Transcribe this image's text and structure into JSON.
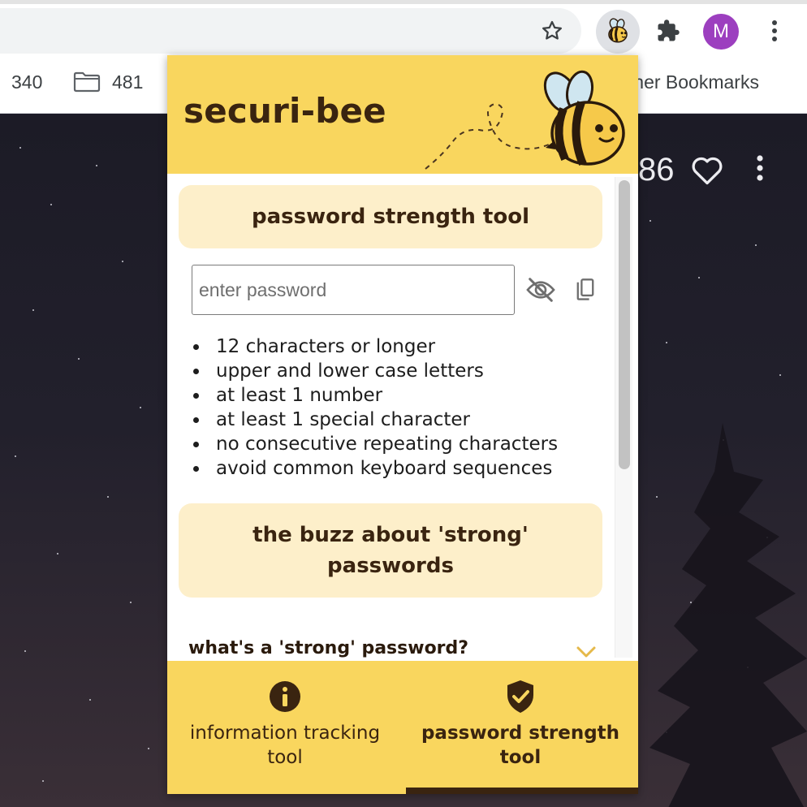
{
  "browser": {
    "avatar_letter": "M",
    "icons": {
      "bookmark": "star-outline-icon",
      "extension": "bee-icon",
      "extensions_menu": "puzzle-icon",
      "menu": "kebab-icon"
    },
    "bookmarks_bar": {
      "items": [
        {
          "label": "340"
        },
        {
          "label": "481",
          "icon": "folder-icon"
        }
      ],
      "other_bookmarks": "Other Bookmarks"
    }
  },
  "page": {
    "counter_text": "86",
    "icons": {
      "like": "heart-outline-icon",
      "more": "kebab-icon"
    }
  },
  "popup": {
    "app_name": "securi-bee",
    "colors": {
      "brand_yellow": "#f9d65e",
      "card": "#fdefca",
      "brand_brown": "#3a2410"
    },
    "tool_heading": "password strength tool",
    "password_input": {
      "placeholder": "enter password",
      "value": ""
    },
    "criteria": [
      "12 characters or longer",
      "upper and lower case letters",
      "at least 1 number",
      "at least 1 special character",
      "no consecutive repeating characters",
      "avoid common keyboard sequences"
    ],
    "buzz_heading": "the buzz about 'strong' passwords",
    "faq": [
      {
        "question": "what's a 'strong' password?",
        "expanded": false
      }
    ],
    "footer": {
      "tabs": [
        {
          "label": "information tracking tool",
          "icon": "info-icon",
          "active": false
        },
        {
          "label": "password strength tool",
          "icon": "shield-check-icon",
          "active": true
        }
      ]
    }
  }
}
